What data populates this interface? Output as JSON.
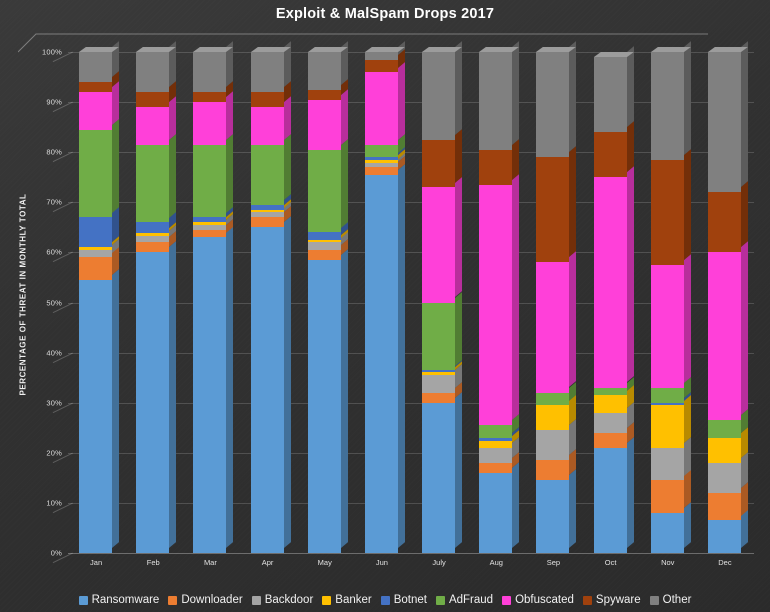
{
  "chart_data": {
    "type": "bar",
    "subtype": "stacked-percentage-3d-column",
    "title": "Exploit & MalSpam Drops 2017",
    "xlabel": "",
    "ylabel": "PERCENTAGE OF THREAT IN MONTHLY TOTAL",
    "ylim": [
      0,
      100
    ],
    "ytick_labels": [
      "0%",
      "10%",
      "20%",
      "30%",
      "40%",
      "50%",
      "60%",
      "70%",
      "80%",
      "90%",
      "100%"
    ],
    "ytick_values": [
      0,
      10,
      20,
      30,
      40,
      50,
      60,
      70,
      80,
      90,
      100
    ],
    "grid": true,
    "legend_position": "bottom",
    "categories": [
      "Jan",
      "Feb",
      "Mar",
      "Apr",
      "May",
      "Jun",
      "July",
      "Aug",
      "Sep",
      "Oct",
      "Nov",
      "Dec"
    ],
    "series": [
      {
        "name": "Ransomware",
        "color": "#5b9bd5",
        "values": [
          54.5,
          60.0,
          63.0,
          65.0,
          58.5,
          75.5,
          30.0,
          16.0,
          14.5,
          21.0,
          8.0,
          6.5
        ]
      },
      {
        "name": "Downloader",
        "color": "#ed7d31",
        "values": [
          4.5,
          2.0,
          1.5,
          2.0,
          2.0,
          1.5,
          2.0,
          2.0,
          4.0,
          3.0,
          6.5,
          5.5
        ]
      },
      {
        "name": "Backdoor",
        "color": "#a5a5a5",
        "values": [
          1.5,
          1.2,
          1.0,
          1.0,
          1.5,
          0.8,
          3.5,
          3.0,
          6.0,
          4.0,
          6.5,
          6.0
        ]
      },
      {
        "name": "Banker",
        "color": "#ffc000",
        "values": [
          0.5,
          0.6,
          0.5,
          0.5,
          0.5,
          0.7,
          0.6,
          1.4,
          5.0,
          3.5,
          8.5,
          5.0
        ]
      },
      {
        "name": "Botnet",
        "color": "#4472c4",
        "values": [
          6.0,
          2.2,
          1.0,
          1.0,
          1.5,
          0.5,
          0.4,
          0.6,
          0.0,
          0.0,
          0.5,
          0.0
        ]
      },
      {
        "name": "AdFraud",
        "color": "#70ad47",
        "values": [
          17.5,
          15.5,
          14.5,
          12.0,
          16.5,
          2.5,
          13.5,
          2.5,
          2.5,
          1.5,
          3.0,
          3.5
        ]
      },
      {
        "name": "Obfuscated",
        "color": "#ff40d9",
        "values": [
          7.5,
          7.5,
          8.5,
          7.5,
          10.0,
          14.5,
          23.0,
          48.0,
          26.0,
          42.0,
          24.5,
          33.5
        ]
      },
      {
        "name": "Spyware",
        "color": "#a0410d",
        "values": [
          2.0,
          3.0,
          2.0,
          3.0,
          2.0,
          2.5,
          9.5,
          7.0,
          21.0,
          9.0,
          21.0,
          12.0
        ]
      },
      {
        "name": "Other",
        "color": "#808080",
        "values": [
          6.0,
          8.0,
          8.0,
          8.0,
          7.5,
          1.5,
          17.5,
          19.5,
          21.0,
          15.0,
          21.5,
          28.0
        ]
      }
    ]
  },
  "legend": {
    "items": [
      {
        "label": "Ransomware",
        "color": "#5b9bd5"
      },
      {
        "label": "Downloader",
        "color": "#ed7d31"
      },
      {
        "label": "Backdoor",
        "color": "#a5a5a5"
      },
      {
        "label": "Banker",
        "color": "#ffc000"
      },
      {
        "label": "Botnet",
        "color": "#4472c4"
      },
      {
        "label": "AdFraud",
        "color": "#70ad47"
      },
      {
        "label": "Obfuscated",
        "color": "#ff40d9"
      },
      {
        "label": "Spyware",
        "color": "#a0410d"
      },
      {
        "label": "Other",
        "color": "#808080"
      }
    ]
  },
  "theme": {
    "background": "#333333",
    "text": "#f0f0f0",
    "grid": "#555555"
  }
}
